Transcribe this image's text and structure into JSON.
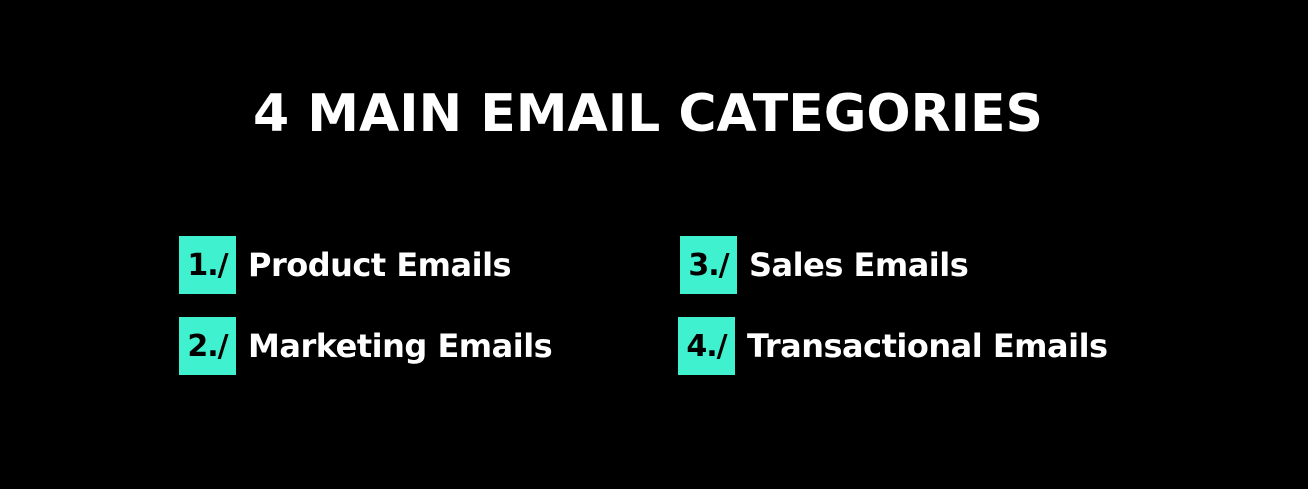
{
  "title": "4 MAIN EMAIL CATEGORIES",
  "accent_color": "#3ff1ce",
  "background_color": "#000000",
  "categories": [
    {
      "number": "1./",
      "label": "Product Emails"
    },
    {
      "number": "2./",
      "label": "Marketing Emails"
    },
    {
      "number": "3./",
      "label": "Sales Emails"
    },
    {
      "number": "4./",
      "label": "Transactional Emails"
    }
  ]
}
